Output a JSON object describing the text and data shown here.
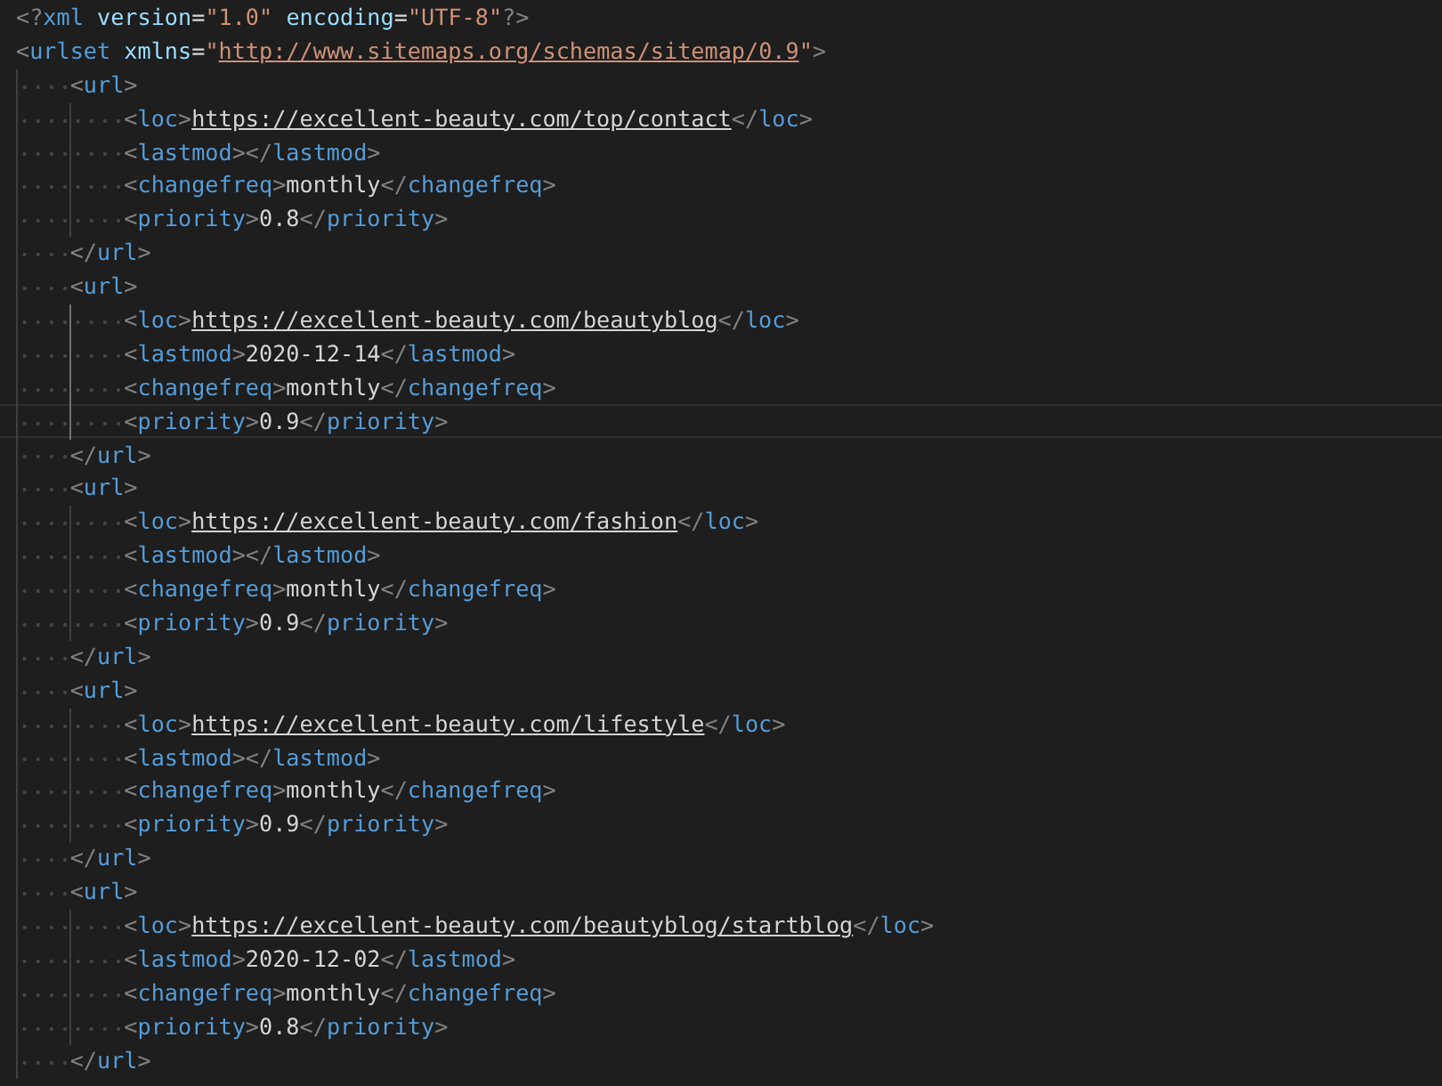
{
  "document": [
    {
      "active": false,
      "open": [
        {
          "kind": "p",
          "text": "<?"
        },
        {
          "kind": "t",
          "text": "xml"
        },
        {
          "kind": "a",
          "text": " version"
        },
        {
          "kind": "o",
          "text": "="
        },
        {
          "kind": "s",
          "text": "\"1.0\""
        },
        {
          "kind": "a",
          "text": " encoding"
        },
        {
          "kind": "o",
          "text": "="
        },
        {
          "kind": "s",
          "text": "\"UTF-8\""
        },
        {
          "kind": "p",
          "text": "?>"
        }
      ]
    },
    {
      "active": false,
      "open": [
        {
          "kind": "p",
          "text": "<"
        },
        {
          "kind": "t",
          "text": "urlset"
        },
        {
          "kind": "a",
          "text": " xmlns"
        },
        {
          "kind": "o",
          "text": "="
        },
        {
          "kind": "s",
          "text": "\""
        },
        {
          "kind": "slink",
          "text": "http://www.sitemaps.org/schemas/sitemap/0.9"
        },
        {
          "kind": "s",
          "text": "\""
        },
        {
          "kind": "p",
          "text": ">"
        }
      ],
      "children": [
        {
          "active": false,
          "open": [
            {
              "kind": "p",
              "text": "<"
            },
            {
              "kind": "t",
              "text": "url"
            },
            {
              "kind": "p",
              "text": ">"
            }
          ],
          "close": [
            {
              "kind": "p",
              "text": "</"
            },
            {
              "kind": "t",
              "text": "url"
            },
            {
              "kind": "p",
              "text": ">"
            }
          ],
          "children": [
            {
              "active": false,
              "open": [
                {
                  "kind": "p",
                  "text": "<"
                },
                {
                  "kind": "t",
                  "text": "loc"
                },
                {
                  "kind": "p",
                  "text": ">"
                },
                {
                  "kind": "link",
                  "text": "https://excellent-beauty.com/top/contact"
                },
                {
                  "kind": "p",
                  "text": "</"
                },
                {
                  "kind": "t",
                  "text": "loc"
                },
                {
                  "kind": "p",
                  "text": ">"
                }
              ]
            },
            {
              "active": false,
              "open": [
                {
                  "kind": "p",
                  "text": "<"
                },
                {
                  "kind": "t",
                  "text": "lastmod"
                },
                {
                  "kind": "p",
                  "text": "></"
                },
                {
                  "kind": "t",
                  "text": "lastmod"
                },
                {
                  "kind": "p",
                  "text": ">"
                }
              ]
            },
            {
              "active": false,
              "open": [
                {
                  "kind": "p",
                  "text": "<"
                },
                {
                  "kind": "t",
                  "text": "changefreq"
                },
                {
                  "kind": "p",
                  "text": ">"
                },
                {
                  "kind": "v",
                  "text": "monthly"
                },
                {
                  "kind": "p",
                  "text": "</"
                },
                {
                  "kind": "t",
                  "text": "changefreq"
                },
                {
                  "kind": "p",
                  "text": ">"
                }
              ]
            },
            {
              "active": false,
              "open": [
                {
                  "kind": "p",
                  "text": "<"
                },
                {
                  "kind": "t",
                  "text": "priority"
                },
                {
                  "kind": "p",
                  "text": ">"
                },
                {
                  "kind": "v",
                  "text": "0.8"
                },
                {
                  "kind": "p",
                  "text": "</"
                },
                {
                  "kind": "t",
                  "text": "priority"
                },
                {
                  "kind": "p",
                  "text": ">"
                }
              ]
            }
          ]
        },
        {
          "active": false,
          "open": [
            {
              "kind": "p",
              "text": "<"
            },
            {
              "kind": "t",
              "text": "url"
            },
            {
              "kind": "p",
              "text": ">"
            }
          ],
          "close": [
            {
              "kind": "p",
              "text": "</"
            },
            {
              "kind": "t",
              "text": "url"
            },
            {
              "kind": "p",
              "text": ">"
            }
          ],
          "children": [
            {
              "active": false,
              "open": [
                {
                  "kind": "p",
                  "text": "<"
                },
                {
                  "kind": "t",
                  "text": "loc"
                },
                {
                  "kind": "p",
                  "text": ">"
                },
                {
                  "kind": "link",
                  "text": "https://excellent-beauty.com/beautyblog"
                },
                {
                  "kind": "p",
                  "text": "</"
                },
                {
                  "kind": "t",
                  "text": "loc"
                },
                {
                  "kind": "p",
                  "text": ">"
                }
              ]
            },
            {
              "active": false,
              "open": [
                {
                  "kind": "p",
                  "text": "<"
                },
                {
                  "kind": "t",
                  "text": "lastmod"
                },
                {
                  "kind": "p",
                  "text": ">"
                },
                {
                  "kind": "v",
                  "text": "2020-12-14"
                },
                {
                  "kind": "p",
                  "text": "</"
                },
                {
                  "kind": "t",
                  "text": "lastmod"
                },
                {
                  "kind": "p",
                  "text": ">"
                }
              ]
            },
            {
              "active": false,
              "open": [
                {
                  "kind": "p",
                  "text": "<"
                },
                {
                  "kind": "t",
                  "text": "changefreq"
                },
                {
                  "kind": "p",
                  "text": ">"
                },
                {
                  "kind": "v",
                  "text": "monthly"
                },
                {
                  "kind": "p",
                  "text": "</"
                },
                {
                  "kind": "t",
                  "text": "changefreq"
                },
                {
                  "kind": "p",
                  "text": ">"
                }
              ]
            },
            {
              "active": true,
              "open": [
                {
                  "kind": "p",
                  "text": "<"
                },
                {
                  "kind": "t",
                  "text": "priority"
                },
                {
                  "kind": "p",
                  "text": ">"
                },
                {
                  "kind": "v",
                  "text": "0.9"
                },
                {
                  "kind": "p",
                  "text": "</"
                },
                {
                  "kind": "t",
                  "text": "priority"
                },
                {
                  "kind": "p",
                  "text": ">"
                }
              ]
            }
          ]
        },
        {
          "active": false,
          "open": [
            {
              "kind": "p",
              "text": "<"
            },
            {
              "kind": "t",
              "text": "url"
            },
            {
              "kind": "p",
              "text": ">"
            }
          ],
          "close": [
            {
              "kind": "p",
              "text": "</"
            },
            {
              "kind": "t",
              "text": "url"
            },
            {
              "kind": "p",
              "text": ">"
            }
          ],
          "children": [
            {
              "active": false,
              "open": [
                {
                  "kind": "p",
                  "text": "<"
                },
                {
                  "kind": "t",
                  "text": "loc"
                },
                {
                  "kind": "p",
                  "text": ">"
                },
                {
                  "kind": "link",
                  "text": "https://excellent-beauty.com/fashion"
                },
                {
                  "kind": "p",
                  "text": "</"
                },
                {
                  "kind": "t",
                  "text": "loc"
                },
                {
                  "kind": "p",
                  "text": ">"
                }
              ]
            },
            {
              "active": false,
              "open": [
                {
                  "kind": "p",
                  "text": "<"
                },
                {
                  "kind": "t",
                  "text": "lastmod"
                },
                {
                  "kind": "p",
                  "text": "></"
                },
                {
                  "kind": "t",
                  "text": "lastmod"
                },
                {
                  "kind": "p",
                  "text": ">"
                }
              ]
            },
            {
              "active": false,
              "open": [
                {
                  "kind": "p",
                  "text": "<"
                },
                {
                  "kind": "t",
                  "text": "changefreq"
                },
                {
                  "kind": "p",
                  "text": ">"
                },
                {
                  "kind": "v",
                  "text": "monthly"
                },
                {
                  "kind": "p",
                  "text": "</"
                },
                {
                  "kind": "t",
                  "text": "changefreq"
                },
                {
                  "kind": "p",
                  "text": ">"
                }
              ]
            },
            {
              "active": false,
              "open": [
                {
                  "kind": "p",
                  "text": "<"
                },
                {
                  "kind": "t",
                  "text": "priority"
                },
                {
                  "kind": "p",
                  "text": ">"
                },
                {
                  "kind": "v",
                  "text": "0.9"
                },
                {
                  "kind": "p",
                  "text": "</"
                },
                {
                  "kind": "t",
                  "text": "priority"
                },
                {
                  "kind": "p",
                  "text": ">"
                }
              ]
            }
          ]
        },
        {
          "active": false,
          "open": [
            {
              "kind": "p",
              "text": "<"
            },
            {
              "kind": "t",
              "text": "url"
            },
            {
              "kind": "p",
              "text": ">"
            }
          ],
          "close": [
            {
              "kind": "p",
              "text": "</"
            },
            {
              "kind": "t",
              "text": "url"
            },
            {
              "kind": "p",
              "text": ">"
            }
          ],
          "children": [
            {
              "active": false,
              "open": [
                {
                  "kind": "p",
                  "text": "<"
                },
                {
                  "kind": "t",
                  "text": "loc"
                },
                {
                  "kind": "p",
                  "text": ">"
                },
                {
                  "kind": "link",
                  "text": "https://excellent-beauty.com/lifestyle"
                },
                {
                  "kind": "p",
                  "text": "</"
                },
                {
                  "kind": "t",
                  "text": "loc"
                },
                {
                  "kind": "p",
                  "text": ">"
                }
              ]
            },
            {
              "active": false,
              "open": [
                {
                  "kind": "p",
                  "text": "<"
                },
                {
                  "kind": "t",
                  "text": "lastmod"
                },
                {
                  "kind": "p",
                  "text": "></"
                },
                {
                  "kind": "t",
                  "text": "lastmod"
                },
                {
                  "kind": "p",
                  "text": ">"
                }
              ]
            },
            {
              "active": false,
              "open": [
                {
                  "kind": "p",
                  "text": "<"
                },
                {
                  "kind": "t",
                  "text": "changefreq"
                },
                {
                  "kind": "p",
                  "text": ">"
                },
                {
                  "kind": "v",
                  "text": "monthly"
                },
                {
                  "kind": "p",
                  "text": "</"
                },
                {
                  "kind": "t",
                  "text": "changefreq"
                },
                {
                  "kind": "p",
                  "text": ">"
                }
              ]
            },
            {
              "active": false,
              "open": [
                {
                  "kind": "p",
                  "text": "<"
                },
                {
                  "kind": "t",
                  "text": "priority"
                },
                {
                  "kind": "p",
                  "text": ">"
                },
                {
                  "kind": "v",
                  "text": "0.9"
                },
                {
                  "kind": "p",
                  "text": "</"
                },
                {
                  "kind": "t",
                  "text": "priority"
                },
                {
                  "kind": "p",
                  "text": ">"
                }
              ]
            }
          ]
        },
        {
          "active": false,
          "open": [
            {
              "kind": "p",
              "text": "<"
            },
            {
              "kind": "t",
              "text": "url"
            },
            {
              "kind": "p",
              "text": ">"
            }
          ],
          "close": [
            {
              "kind": "p",
              "text": "</"
            },
            {
              "kind": "t",
              "text": "url"
            },
            {
              "kind": "p",
              "text": ">"
            }
          ],
          "children": [
            {
              "active": false,
              "open": [
                {
                  "kind": "p",
                  "text": "<"
                },
                {
                  "kind": "t",
                  "text": "loc"
                },
                {
                  "kind": "p",
                  "text": ">"
                },
                {
                  "kind": "link",
                  "text": "https://excellent-beauty.com/beautyblog/startblog"
                },
                {
                  "kind": "p",
                  "text": "</"
                },
                {
                  "kind": "t",
                  "text": "loc"
                },
                {
                  "kind": "p",
                  "text": ">"
                }
              ]
            },
            {
              "active": false,
              "open": [
                {
                  "kind": "p",
                  "text": "<"
                },
                {
                  "kind": "t",
                  "text": "lastmod"
                },
                {
                  "kind": "p",
                  "text": ">"
                },
                {
                  "kind": "v",
                  "text": "2020-12-02"
                },
                {
                  "kind": "p",
                  "text": "</"
                },
                {
                  "kind": "t",
                  "text": "lastmod"
                },
                {
                  "kind": "p",
                  "text": ">"
                }
              ]
            },
            {
              "active": false,
              "open": [
                {
                  "kind": "p",
                  "text": "<"
                },
                {
                  "kind": "t",
                  "text": "changefreq"
                },
                {
                  "kind": "p",
                  "text": ">"
                },
                {
                  "kind": "v",
                  "text": "monthly"
                },
                {
                  "kind": "p",
                  "text": "</"
                },
                {
                  "kind": "t",
                  "text": "changefreq"
                },
                {
                  "kind": "p",
                  "text": ">"
                }
              ]
            },
            {
              "active": false,
              "open": [
                {
                  "kind": "p",
                  "text": "<"
                },
                {
                  "kind": "t",
                  "text": "priority"
                },
                {
                  "kind": "p",
                  "text": ">"
                },
                {
                  "kind": "v",
                  "text": "0.8"
                },
                {
                  "kind": "p",
                  "text": "</"
                },
                {
                  "kind": "t",
                  "text": "priority"
                },
                {
                  "kind": "p",
                  "text": ">"
                }
              ]
            }
          ]
        }
      ]
    }
  ]
}
